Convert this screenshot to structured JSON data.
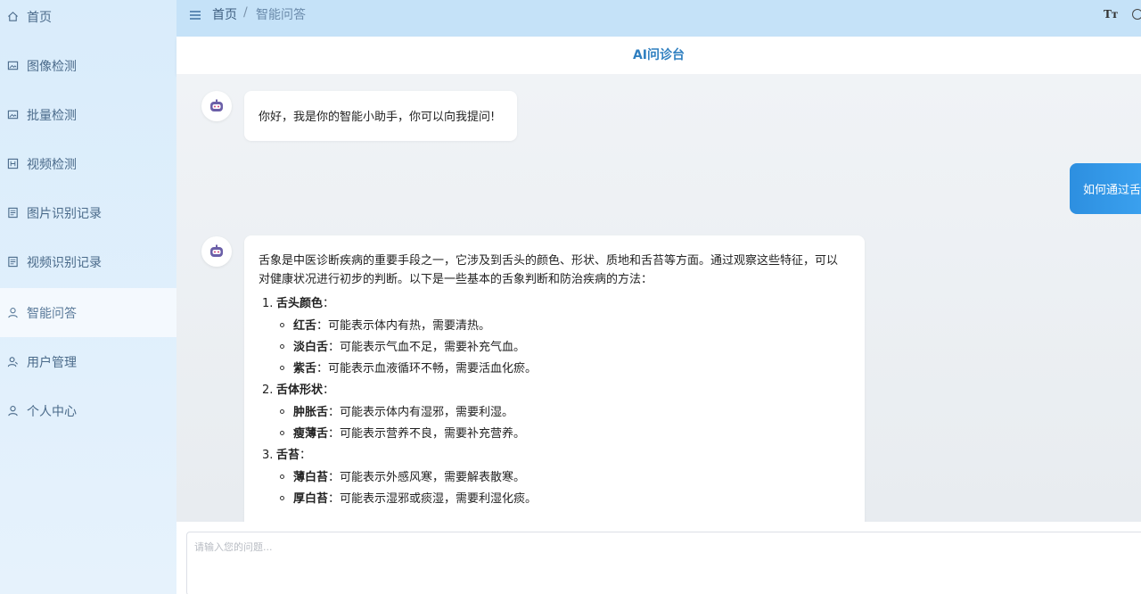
{
  "sidebar": {
    "items": [
      {
        "label": "首页",
        "icon": "home-icon"
      },
      {
        "label": "图像检测",
        "icon": "image-icon"
      },
      {
        "label": "批量检测",
        "icon": "image-icon"
      },
      {
        "label": "视频检测",
        "icon": "video-icon"
      },
      {
        "label": "图片识别记录",
        "icon": "document-icon"
      },
      {
        "label": "视频识别记录",
        "icon": "document-icon"
      },
      {
        "label": "智能问答",
        "icon": "user-icon",
        "active": true
      },
      {
        "label": "用户管理",
        "icon": "user-group-icon"
      },
      {
        "label": "个人中心",
        "icon": "user-icon"
      }
    ]
  },
  "header": {
    "breadcrumb_home": "首页",
    "breadcrumb_sep": "/",
    "breadcrumb_current": "智能问答",
    "font_size_icon": "Tт"
  },
  "chat": {
    "title": "AI问诊台",
    "greeting": "你好，我是你的智能小助手，你可以向我提问!",
    "user_question": "如何通过舌象判断健康状况？",
    "answer": {
      "intro": "舌象是中医诊断疾病的重要手段之一，它涉及到舌头的颜色、形状、质地和舌苔等方面。通过观察这些特征，可以对健康状况进行初步的判断。以下是一些基本的舌象判断和防治疾病的方法：",
      "sections": [
        {
          "num": "1.",
          "title": "舌头颜色",
          "colon": "：",
          "items": [
            {
              "term": "红舌",
              "desc": "：可能表示体内有热，需要清热。"
            },
            {
              "term": "淡白舌",
              "desc": "：可能表示气血不足，需要补充气血。"
            },
            {
              "term": "紫舌",
              "desc": "：可能表示血液循环不畅，需要活血化瘀。"
            }
          ]
        },
        {
          "num": "2.",
          "title": "舌体形状",
          "colon": "：",
          "items": [
            {
              "term": "肿胀舌",
              "desc": "：可能表示体内有湿邪，需要利湿。"
            },
            {
              "term": "瘦薄舌",
              "desc": "：可能表示营养不良，需要补充营养。"
            }
          ]
        },
        {
          "num": "3.",
          "title": "舌苔",
          "colon": "：",
          "items": [
            {
              "term": "薄白苔",
              "desc": "：可能表示外感风寒，需要解表散寒。"
            },
            {
              "term": "厚白苔",
              "desc": "：可能表示湿邪或痰湿，需要利湿化痰。"
            }
          ]
        }
      ]
    }
  },
  "input": {
    "placeholder": "请输入您的问题..."
  },
  "colors": {
    "sidebar_bg": "#d9ecfb",
    "header_bg": "#c5e2f8",
    "accent": "#2f7fc0",
    "user_bubble": "#2d8fe0"
  }
}
